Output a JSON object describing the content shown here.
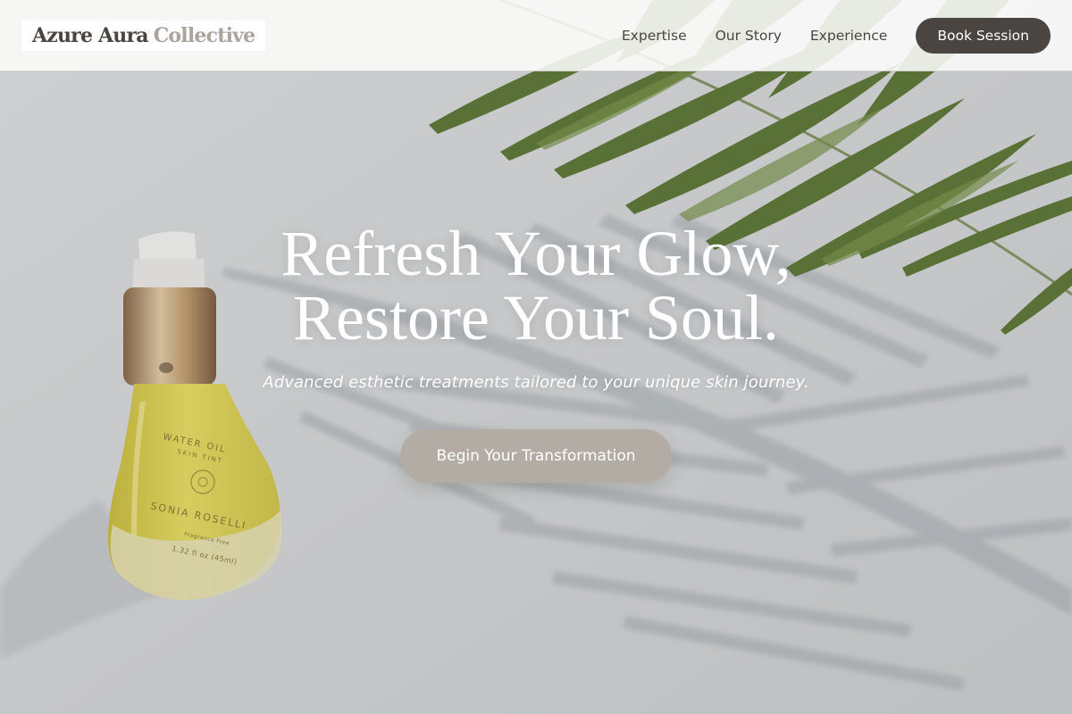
{
  "header": {
    "logo": {
      "main": "Azure Aura",
      "accent": "Collective"
    },
    "nav": [
      {
        "label": "Expertise"
      },
      {
        "label": "Our Story"
      },
      {
        "label": "Experience"
      }
    ],
    "cta_label": "Book Session"
  },
  "hero": {
    "headline_line1": "Refresh Your Glow,",
    "headline_line2": "Restore Your Soul.",
    "subheadline": "Advanced esthetic treatments tailored to your unique skin journey.",
    "cta_label": "Begin Your Transformation",
    "product": {
      "name": "WATER OIL",
      "subtitle": "SKIN TINT",
      "brand": "SONIA ROSELLI",
      "note": "Fragrance Free",
      "volume": "1.32 fl oz (45ml)"
    }
  },
  "colors": {
    "brand_dark": "#4a4541",
    "brand_muted": "#aba49c",
    "cta_button": "#b3aca4",
    "leaf_green": "#4f6b24"
  },
  "icons": {
    "leaf": "palm-frond-icon",
    "product": "serum-bottle-icon"
  }
}
